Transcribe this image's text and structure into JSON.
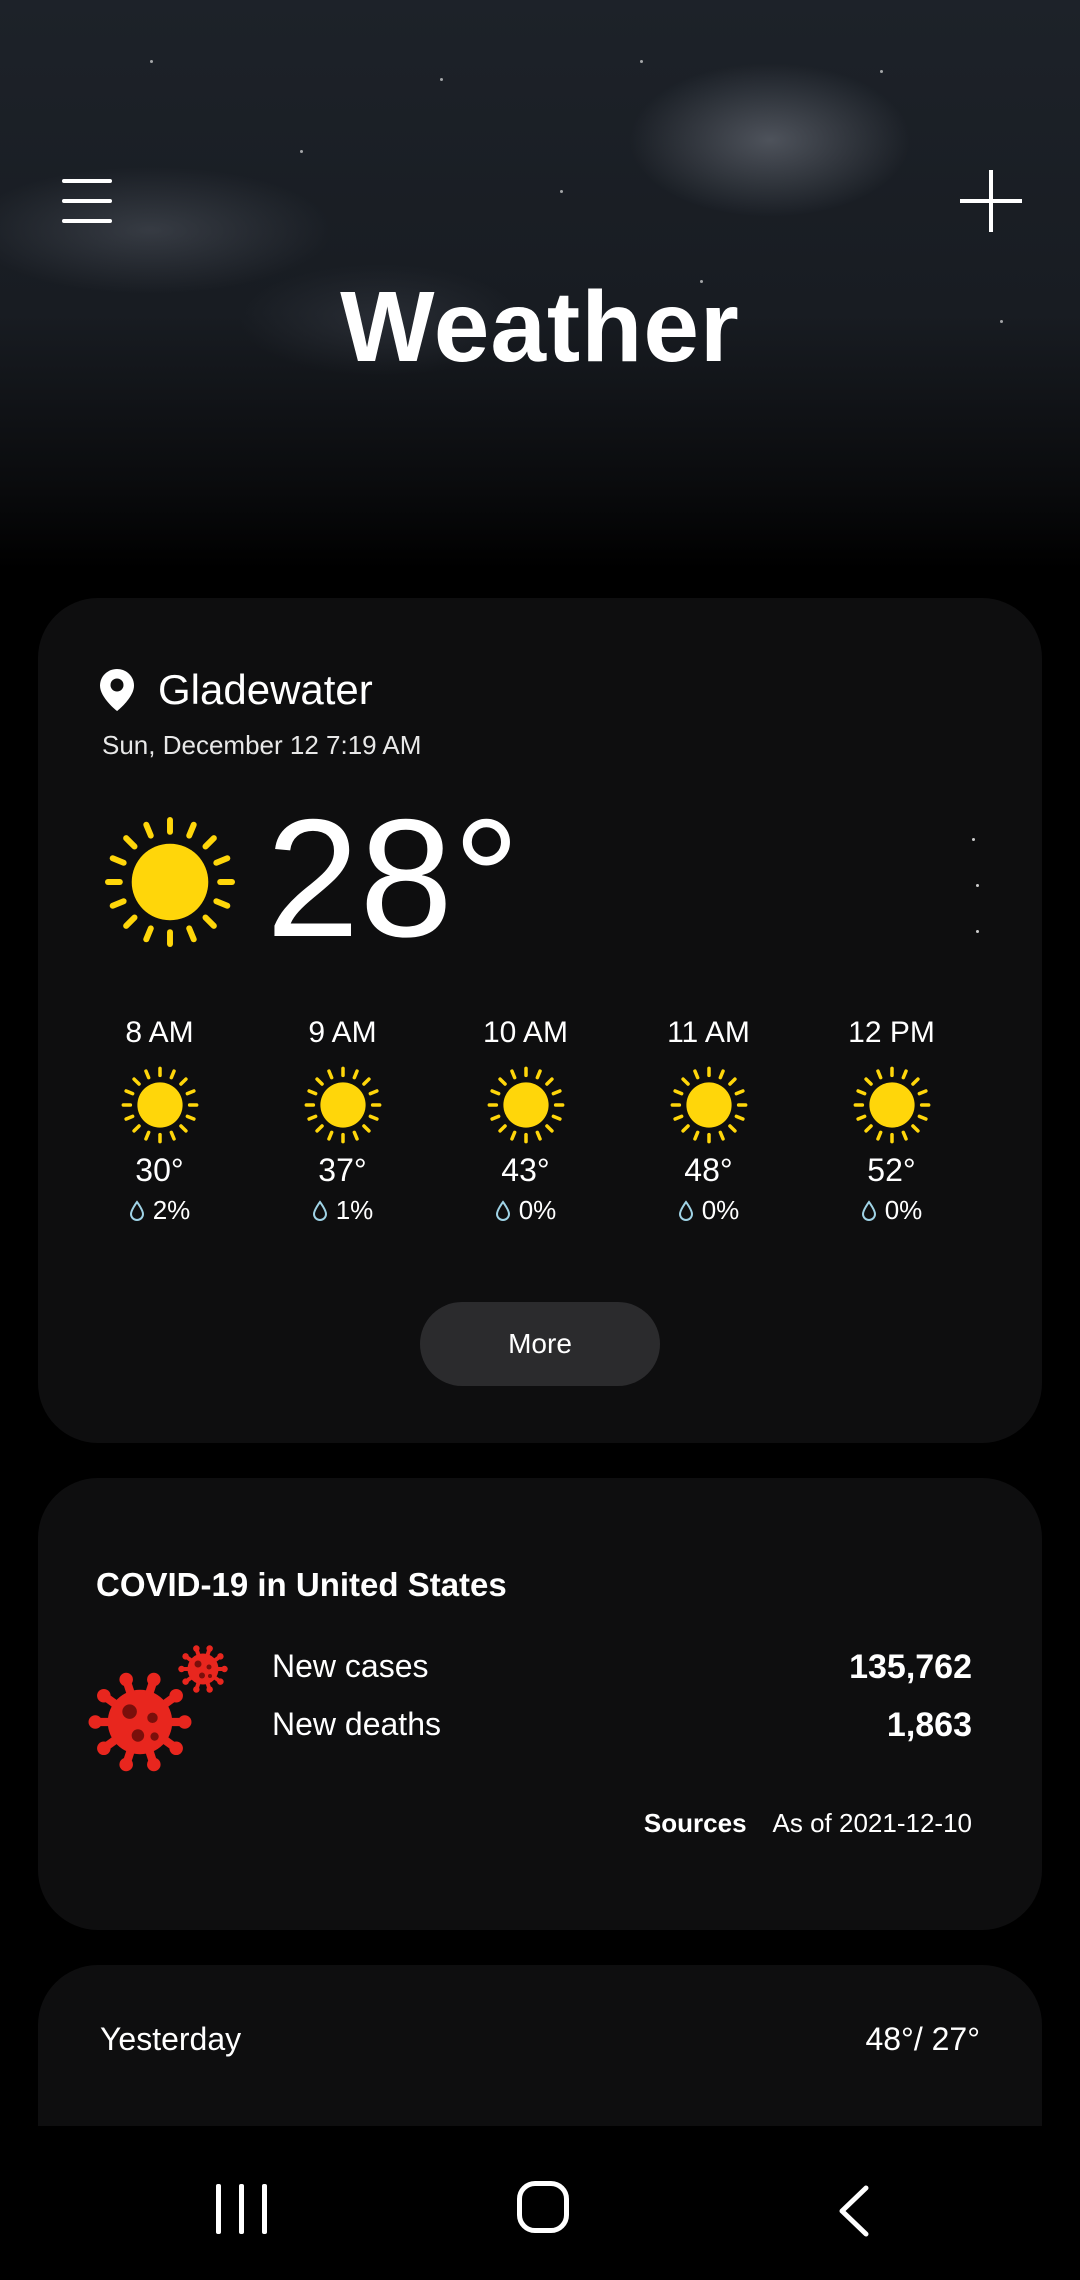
{
  "app": {
    "title": "Weather"
  },
  "location": {
    "name": "Gladewater",
    "datetime": "Sun, December 12 7:19 AM"
  },
  "current": {
    "temp": "28°",
    "icon": "sun-icon"
  },
  "hourly": [
    {
      "time": "8 AM",
      "temp": "30°",
      "precip": "2%"
    },
    {
      "time": "9 AM",
      "temp": "37°",
      "precip": "1%"
    },
    {
      "time": "10 AM",
      "temp": "43°",
      "precip": "0%"
    },
    {
      "time": "11 AM",
      "temp": "48°",
      "precip": "0%"
    },
    {
      "time": "12 PM",
      "temp": "52°",
      "precip": "0%"
    }
  ],
  "more_label": "More",
  "covid": {
    "title": "COVID-19 in United States",
    "new_cases_label": "New cases",
    "new_cases_value": "135,762",
    "new_deaths_label": "New deaths",
    "new_deaths_value": "1,863",
    "sources_label": "Sources",
    "as_of": "As of 2021-12-10"
  },
  "daily": [
    {
      "day": "Yesterday",
      "range": "48°/ 27°"
    }
  ],
  "colors": {
    "sun": "#FFD60A",
    "virus": "#E8261E",
    "card": "#0E0E0F",
    "button": "#2B2B2D"
  }
}
